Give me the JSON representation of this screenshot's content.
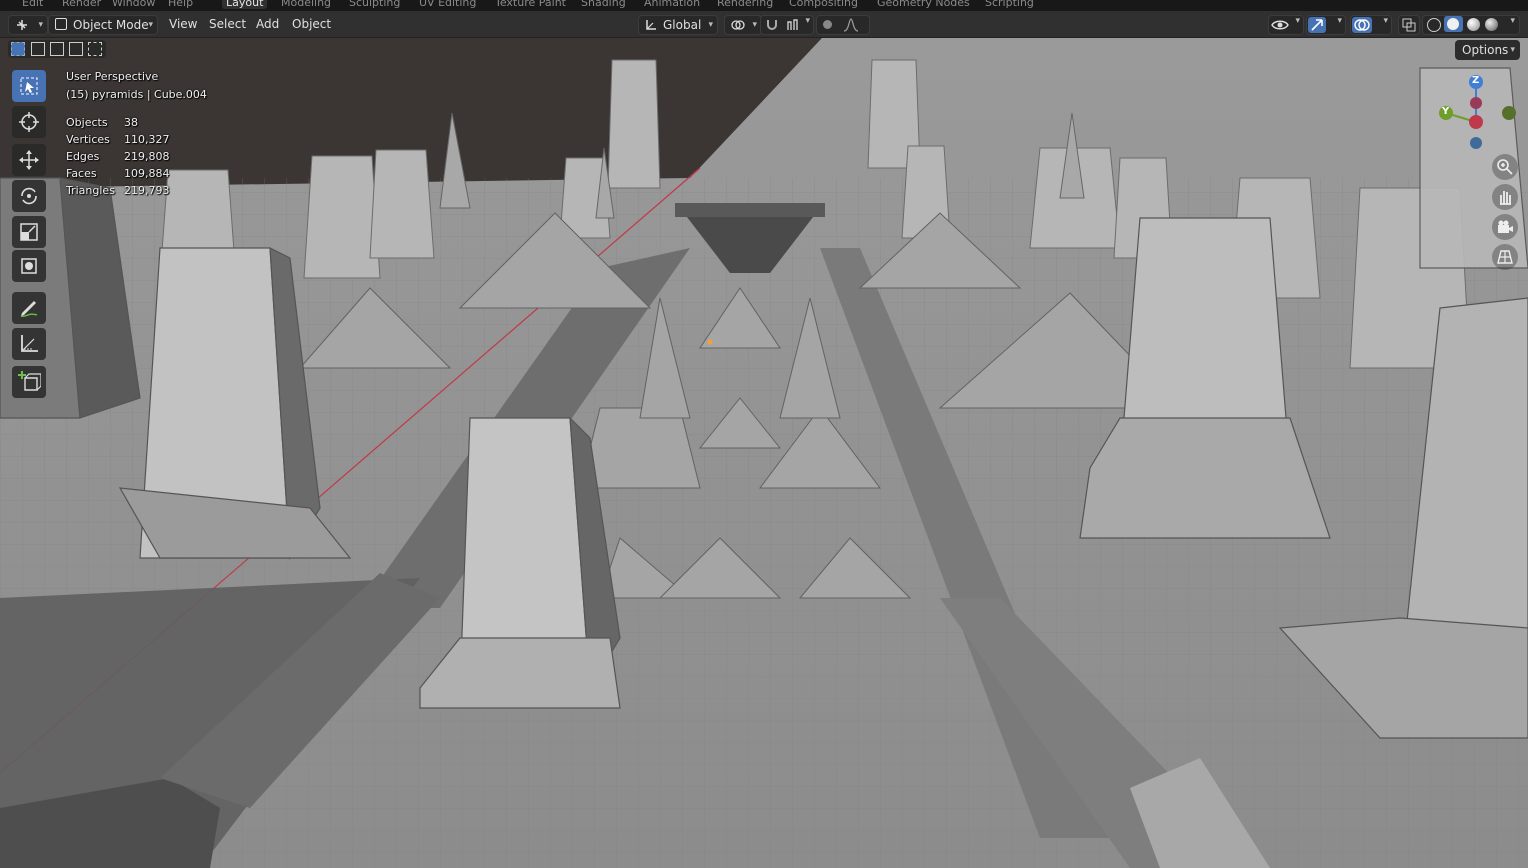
{
  "workspace_tabs": [
    "Layout",
    "Modeling",
    "Sculpting",
    "UV Editing",
    "Texture Paint",
    "Shading",
    "Animation",
    "Rendering",
    "Compositing",
    "Geometry Nodes",
    "Scripting"
  ],
  "active_workspace": "Layout",
  "top_menu": [
    "Edit",
    "Render",
    "Window",
    "Help"
  ],
  "header": {
    "mode": "Object Mode",
    "menus": [
      "View",
      "Select",
      "Add",
      "Object"
    ],
    "transform_orientation": "Global"
  },
  "viewport": {
    "view_name": "User Perspective",
    "context": "(15) pyramids | Cube.004",
    "stats": [
      {
        "label": "Objects",
        "value": "38"
      },
      {
        "label": "Vertices",
        "value": "110,327"
      },
      {
        "label": "Edges",
        "value": "219,808"
      },
      {
        "label": "Faces",
        "value": "109,884"
      },
      {
        "label": "Triangles",
        "value": "219,793"
      }
    ],
    "options_label": "Options"
  },
  "tools": [
    "select-box-icon",
    "cursor-icon",
    "move-icon",
    "rotate-icon",
    "scale-icon",
    "transform-icon",
    "annotate-icon",
    "measure-icon",
    "add-cube-icon"
  ],
  "gizmo_axes": [
    "Z",
    "Y"
  ],
  "colors": {
    "accent": "#4772b3",
    "header": "#303030",
    "x_axis": "#c0394a",
    "y_axis": "#6f9e2a",
    "z_axis": "#3f7fd6"
  }
}
